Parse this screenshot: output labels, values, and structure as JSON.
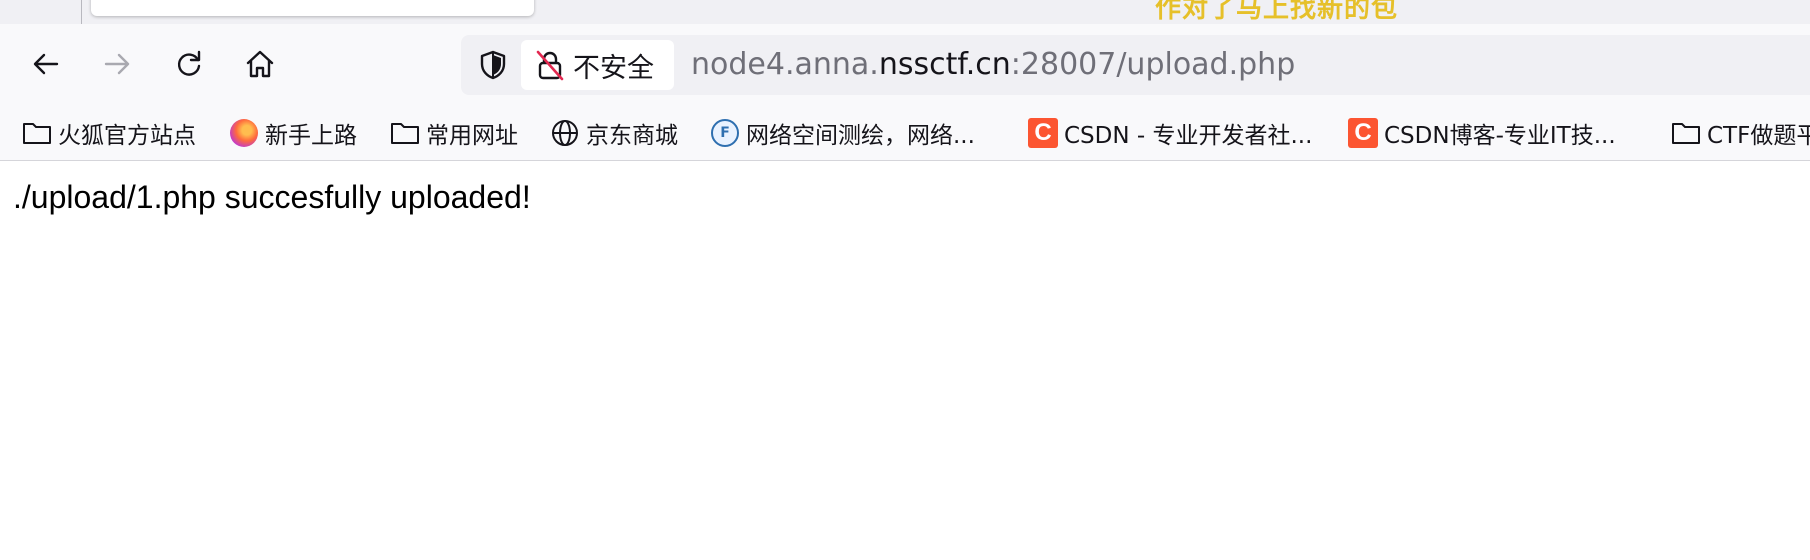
{
  "tabstrip": {
    "overflow_text": "作对了马上找新的包"
  },
  "navbar": {
    "back_icon": "arrow-left-icon",
    "forward_icon": "arrow-right-icon",
    "reload_icon": "reload-icon",
    "home_icon": "home-icon",
    "security_label": "不安全",
    "url_prefix": "node4.anna.",
    "url_domain": "nssctf.cn",
    "url_suffix": ":28007/upload.php"
  },
  "bookmarks": [
    {
      "label": "火狐官方站点",
      "icon": "folder-icon"
    },
    {
      "label": "新手上路",
      "icon": "firefox-icon"
    },
    {
      "label": "常用网址",
      "icon": "folder-icon"
    },
    {
      "label": "京东商城",
      "icon": "globe-icon"
    },
    {
      "label": "网络空间测绘，网络...",
      "icon": "fofa-icon"
    },
    {
      "label": "CSDN - 专业开发者社...",
      "icon": "csdn-icon"
    },
    {
      "label": "CSDN博客-专业IT技...",
      "icon": "csdn-icon"
    },
    {
      "label": "CTF做题平",
      "icon": "folder-icon"
    }
  ],
  "page": {
    "message": "./upload/1.php succesfully uploaded!"
  },
  "colors": {
    "csdn_brand": "#fc5531",
    "toolbar_bg": "#f9f9fb",
    "urlbar_bg": "#f0f0f4"
  }
}
